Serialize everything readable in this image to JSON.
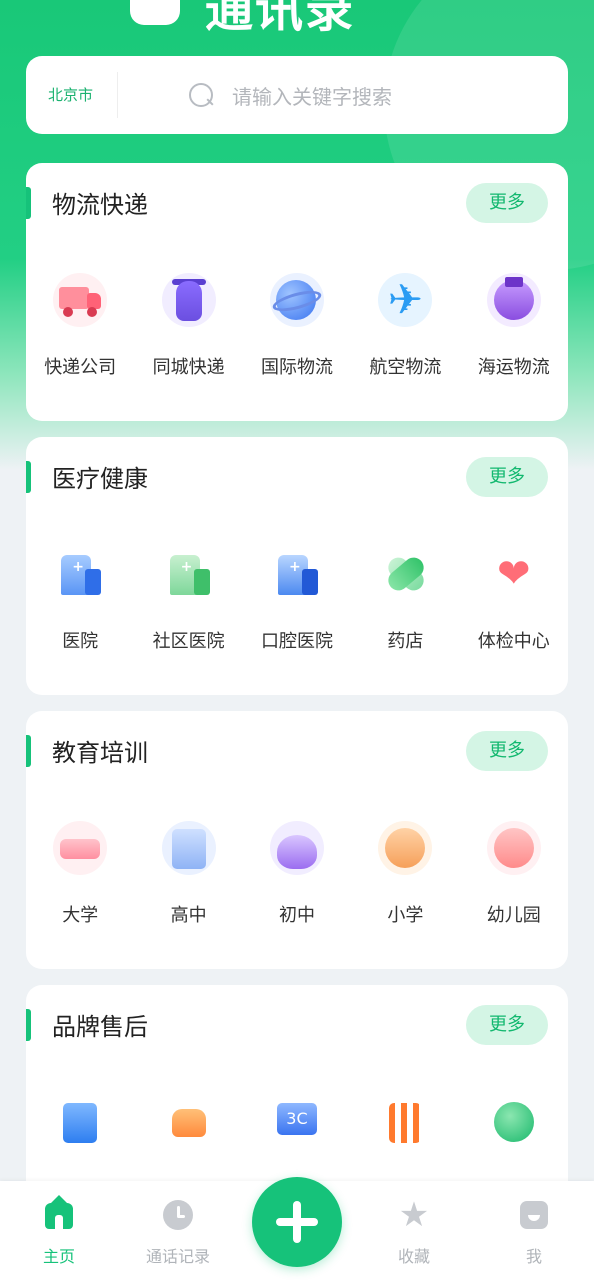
{
  "header": {
    "logo_text": "通讯录"
  },
  "search": {
    "city": "北京市",
    "placeholder": "请输入关键字搜索"
  },
  "sections": [
    {
      "title": "物流快递",
      "more_label": "更多",
      "items": [
        {
          "label": "快递公司",
          "icon": "truck-icon"
        },
        {
          "label": "同城快递",
          "icon": "scooter-icon"
        },
        {
          "label": "国际物流",
          "icon": "globe-icon"
        },
        {
          "label": "航空物流",
          "icon": "airplane-icon"
        },
        {
          "label": "海运物流",
          "icon": "ship-icon"
        }
      ]
    },
    {
      "title": "医疗健康",
      "more_label": "更多",
      "items": [
        {
          "label": "医院",
          "icon": "hospital-icon"
        },
        {
          "label": "社区医院",
          "icon": "community-hospital-icon"
        },
        {
          "label": "口腔医院",
          "icon": "dental-hospital-icon"
        },
        {
          "label": "药店",
          "icon": "pill-icon"
        },
        {
          "label": "体检中心",
          "icon": "heart-icon"
        }
      ]
    },
    {
      "title": "教育培训",
      "more_label": "更多",
      "items": [
        {
          "label": "大学",
          "icon": "graduation-cap-icon"
        },
        {
          "label": "高中",
          "icon": "chart-board-icon"
        },
        {
          "label": "初中",
          "icon": "flask-icon"
        },
        {
          "label": "小学",
          "icon": "kid-face-icon"
        },
        {
          "label": "幼儿园",
          "icon": "baby-face-icon"
        }
      ]
    },
    {
      "title": "品牌售后",
      "more_label": "更多",
      "items": [
        {
          "label": "",
          "icon": "fridge-icon"
        },
        {
          "label": "",
          "icon": "car-icon"
        },
        {
          "label": "3C",
          "icon": "3c-monitor-icon"
        },
        {
          "label": "",
          "icon": "fork-knife-icon"
        },
        {
          "label": "",
          "icon": "earth-icon"
        }
      ]
    }
  ],
  "bottom_nav": [
    {
      "label": "主页",
      "icon": "home-icon",
      "active": true
    },
    {
      "label": "通话记录",
      "icon": "clock-icon",
      "active": false
    },
    {
      "label": "",
      "icon": "plus-icon",
      "active": false
    },
    {
      "label": "收藏",
      "icon": "star-icon",
      "active": false
    },
    {
      "label": "我",
      "icon": "user-icon",
      "active": false
    }
  ],
  "colors": {
    "brand_green": "#16c27a",
    "more_bg": "#d4f5e5",
    "page_bg": "#eef2f5"
  }
}
